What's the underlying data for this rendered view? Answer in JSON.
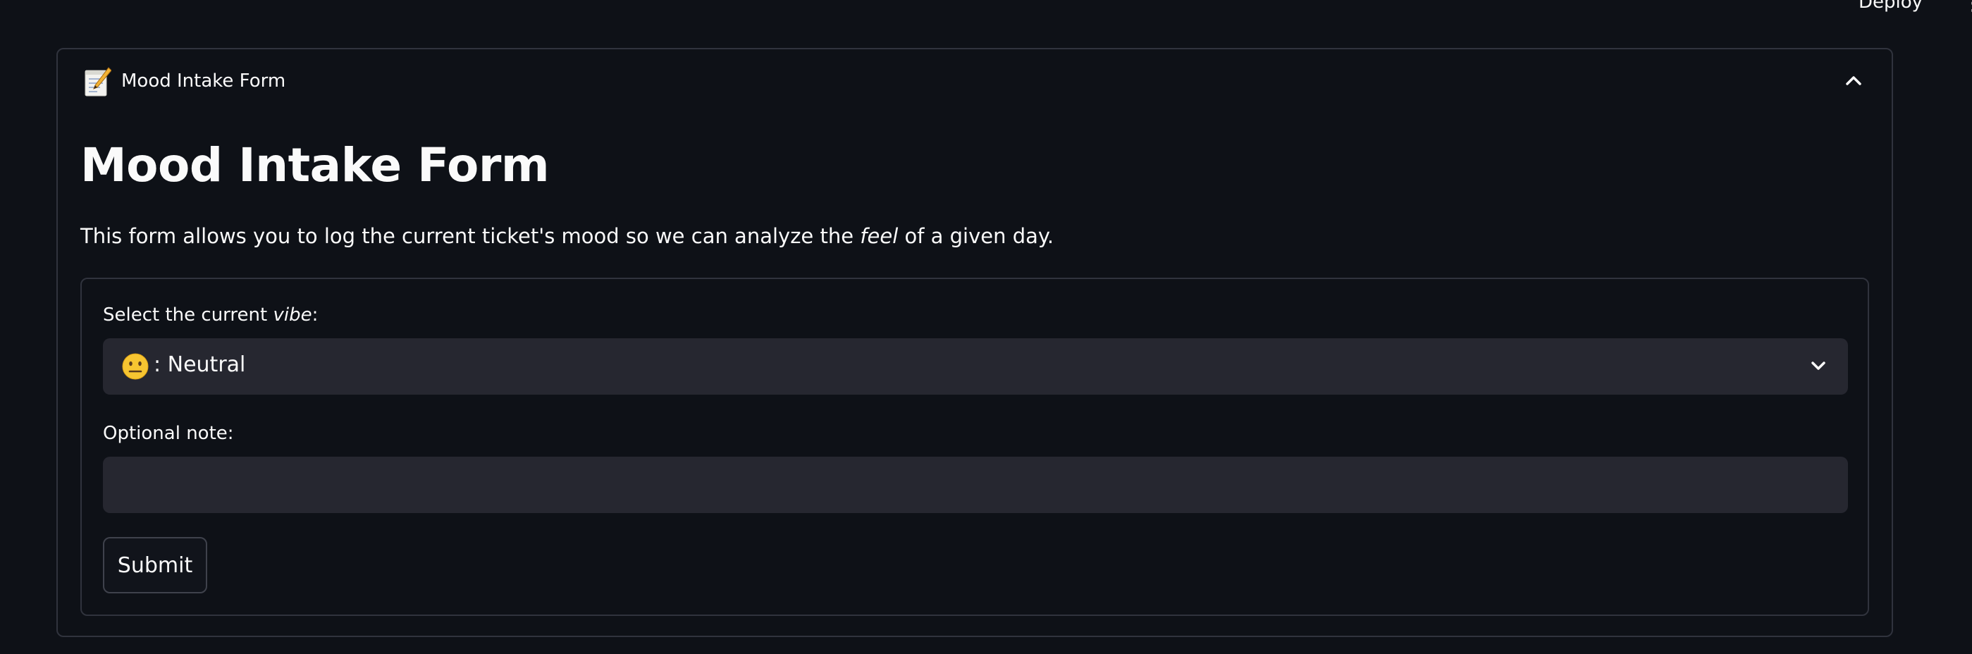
{
  "topbar": {
    "deploy_label": "Deploy"
  },
  "expander": {
    "title": "Mood Intake Form",
    "icon": "memo-icon"
  },
  "main": {
    "heading": "Mood Intake Form",
    "description_before": "This form allows you to log the current ticket's mood so we can analyze the ",
    "description_emphasis": "feel",
    "description_after": " of a given day."
  },
  "form": {
    "vibe_label_before": "Select the current ",
    "vibe_label_emphasis": "vibe",
    "vibe_label_after": ":",
    "vibe_selected": ": Neutral",
    "vibe_selected_icon": "neutral-face-icon",
    "note_label": "Optional note:",
    "note_value": "",
    "submit_label": "Submit"
  },
  "colors": {
    "background": "#0e1117",
    "surface": "#262730",
    "border": "#30333d",
    "text": "#fafafa",
    "emoji_yellow": "#f7c531"
  }
}
